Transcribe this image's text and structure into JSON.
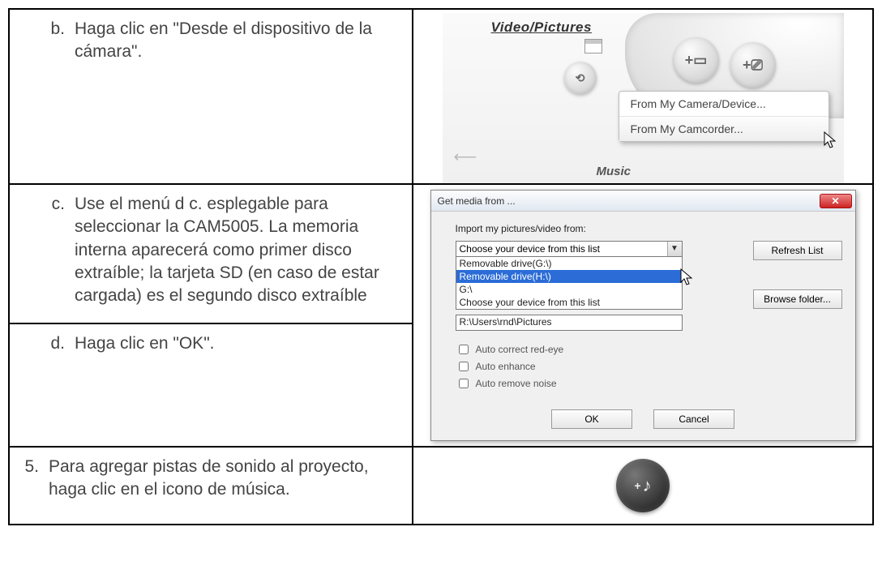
{
  "row_b": {
    "marker": "b.",
    "text": "Haga clic en \"Desde el dispositivo de la cámara\".",
    "panel_title": "Video/Pictures",
    "menu_item_1": "From My Camera/Device...",
    "menu_item_2": "From My Camcorder...",
    "music_label": "Music"
  },
  "row_c": {
    "marker": "c.",
    "text": "Use el menú d c. esplegable para seleccionar la CAM5005. La memoria interna aparecerá como primer disco extraíble; la tarjeta SD (en caso de estar cargada) es el segundo disco extraíble"
  },
  "row_d": {
    "marker": "d.",
    "text": "Haga clic en \"OK\"."
  },
  "dialog": {
    "title": "Get media from ...",
    "import_label": "Import my pictures/video from:",
    "combo_value": "Choose your device from this list",
    "options": {
      "0": "Removable drive(G:\\)",
      "1": "Removable drive(H:\\)",
      "2": "G:\\",
      "3": "Choose your device from this list"
    },
    "path_value": "R:\\Users\\rnd\\Pictures",
    "refresh": "Refresh List",
    "browse": "Browse folder...",
    "check1": "Auto correct red-eye",
    "check2": "Auto enhance",
    "check3": "Auto remove noise",
    "ok": "OK",
    "cancel": "Cancel"
  },
  "row_5": {
    "marker": "5.",
    "text": "Para agregar pistas de sonido al proyecto, haga clic en el icono de música."
  }
}
